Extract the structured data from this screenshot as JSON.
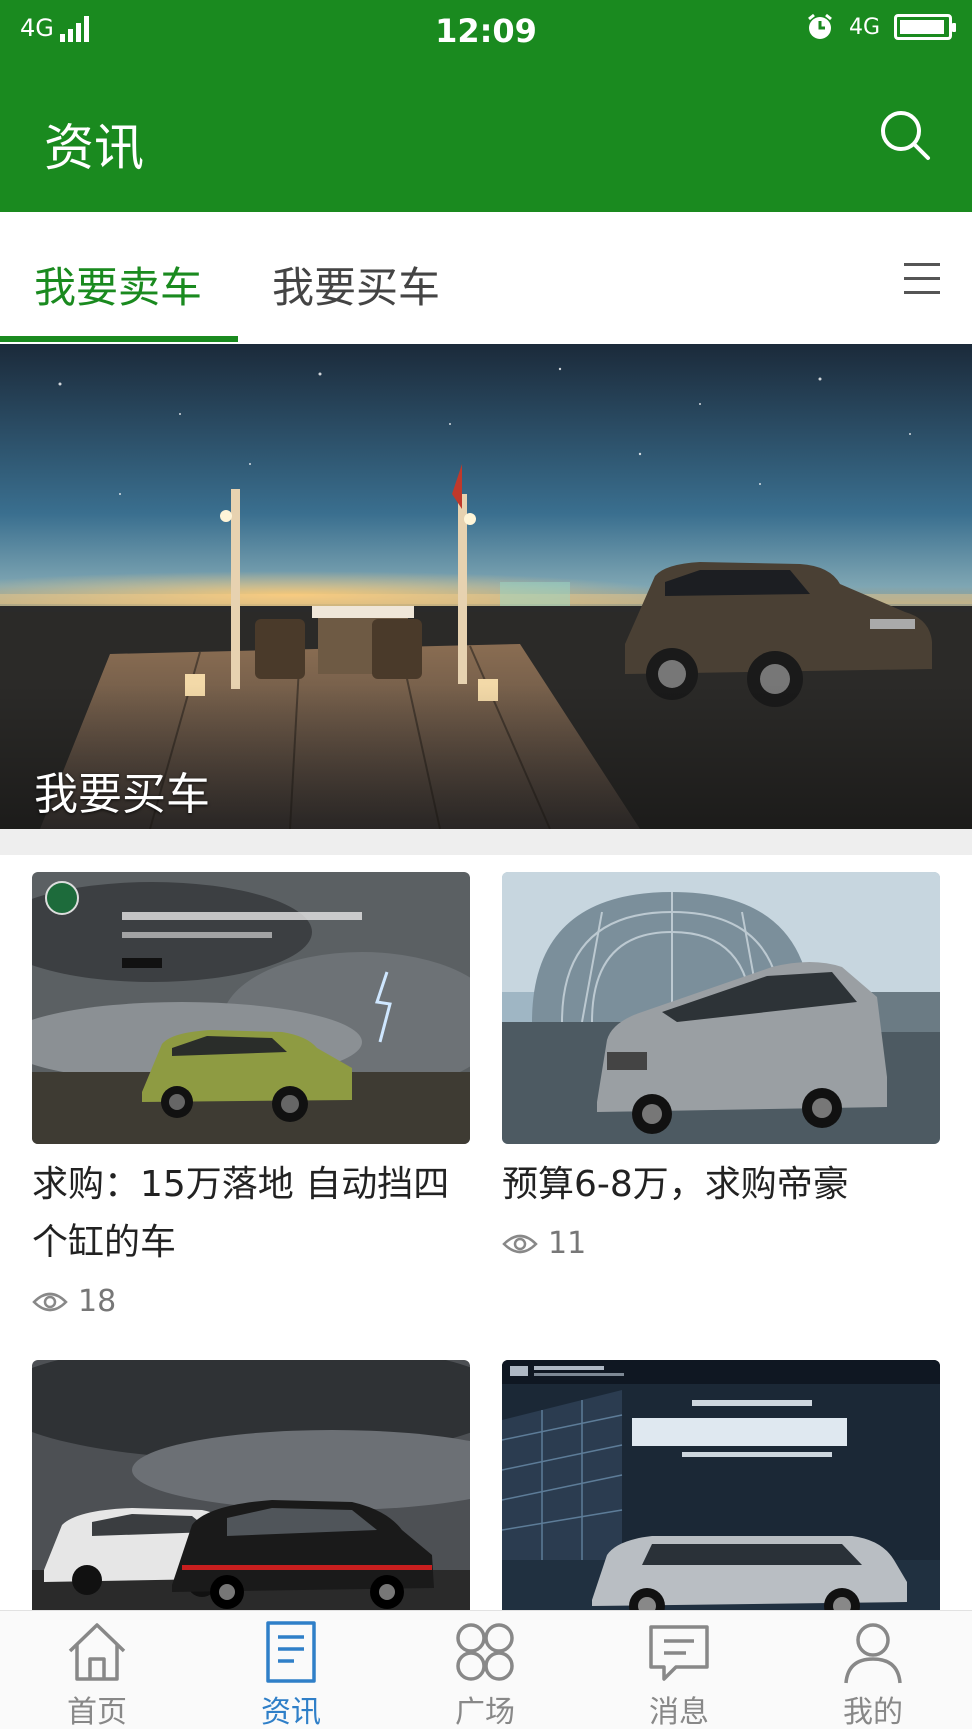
{
  "status_bar": {
    "network": "4G",
    "time": "12:09",
    "network_right": "4G",
    "battery_level": 0.95
  },
  "app_bar": {
    "title": "资讯"
  },
  "tabs": [
    {
      "label": "我要卖车",
      "active": true
    },
    {
      "label": "我要买车",
      "active": false
    }
  ],
  "banner": {
    "caption": "我要买车"
  },
  "cards": [
    {
      "title": "求购：15万落地 自动挡四个缸的车",
      "views": "18"
    },
    {
      "title": "预算6-8万，求购帝豪",
      "views": "11"
    },
    {
      "title": "",
      "views": ""
    },
    {
      "title": "",
      "views": ""
    }
  ],
  "bottom_nav": [
    {
      "label": "首页",
      "icon": "home-icon"
    },
    {
      "label": "资讯",
      "icon": "news-icon",
      "active": true
    },
    {
      "label": "广场",
      "icon": "square-grid-icon"
    },
    {
      "label": "消息",
      "icon": "message-icon"
    },
    {
      "label": "我的",
      "icon": "user-icon"
    }
  ],
  "colors": {
    "primary": "#1a8a1f",
    "nav_active": "#2f7fc8",
    "text": "#222222",
    "muted": "#888888"
  }
}
